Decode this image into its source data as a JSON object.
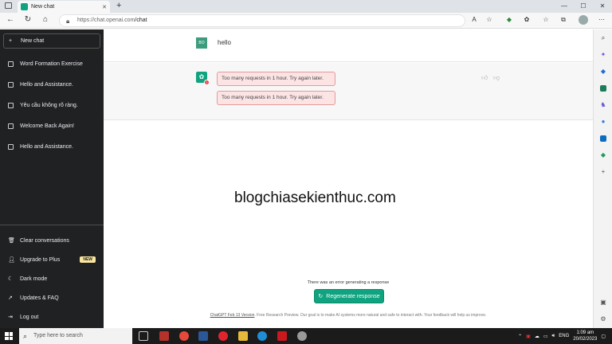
{
  "browser": {
    "tab_title": "New chat",
    "tab_close": "✕",
    "new_tab": "+",
    "window_controls": [
      "—",
      "☐",
      "✕"
    ],
    "url_host": "https://chat.openai.com",
    "url_path": "/chat"
  },
  "sidebar": {
    "new_chat_label": "New chat",
    "history": [
      "Word Formation Exercise",
      "Hello and Assistance.",
      "Yêu cầu không rõ ràng.",
      "Welcome Back Again!",
      "Hello and Assistance."
    ],
    "bottom": [
      {
        "label": "Clear conversations",
        "icon": "trash-icon"
      },
      {
        "label": "Upgrade to Plus",
        "icon": "user-icon",
        "badge": "NEW"
      },
      {
        "label": "Dark mode",
        "icon": "moon-icon"
      },
      {
        "label": "Updates & FAQ",
        "icon": "external-link-icon"
      },
      {
        "label": "Log out",
        "icon": "logout-icon"
      }
    ]
  },
  "conversation": {
    "user_initials": "BO",
    "user_message": "hello",
    "bot_warning": "!",
    "errors": [
      "Too many requests in 1 hour. Try again later.",
      "Too many requests in 1 hour. Try again later."
    ]
  },
  "watermark": "blogchiasekienthuc.com",
  "composer": {
    "error_text": "There was an error generating a response",
    "regenerate_label": "Regenerate response",
    "footer_link": "ChatGPT Feb 13 Version",
    "footer_text": ". Free Research Preview. Our goal is to make AI systems more natural and safe to interact with. Your feedback will help us improve."
  },
  "taskbar": {
    "search_placeholder": "Type here to search",
    "language": "ENG",
    "time": "1:09 am",
    "date": "20/02/2023"
  },
  "colors": {
    "sidebar_bg": "#202123",
    "accent": "#10a37f",
    "error_bg": "#fce4e4",
    "error_border": "#e59a9a",
    "new_badge": "#fae69e"
  }
}
